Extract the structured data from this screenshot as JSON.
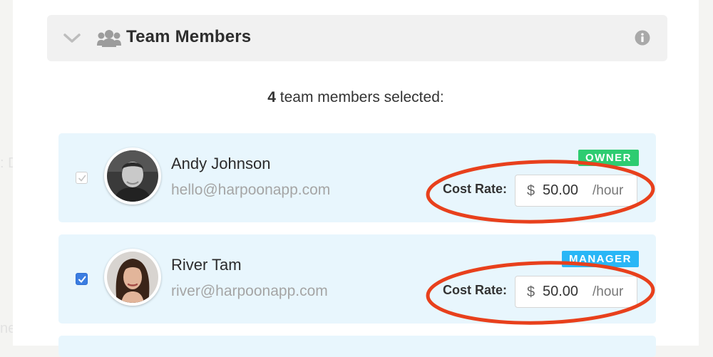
{
  "section": {
    "title": "Team Members"
  },
  "summary": {
    "count": "4",
    "text": " team members selected:"
  },
  "members": [
    {
      "name": "Andy Johnson",
      "email": "hello@harpoonapp.com",
      "role": "OWNER",
      "role_color": "#2ecc71",
      "checked": false,
      "cost_label": "Cost Rate:",
      "currency": "$",
      "rate": "50.00",
      "unit": "/hour"
    },
    {
      "name": "River Tam",
      "email": "river@harpoonapp.com",
      "role": "MANAGER",
      "role_color": "#29b6f6",
      "checked": true,
      "cost_label": "Cost Rate:",
      "currency": "$",
      "rate": "50.00",
      "unit": "/hour"
    }
  ],
  "annotation_color": "#e8401c"
}
